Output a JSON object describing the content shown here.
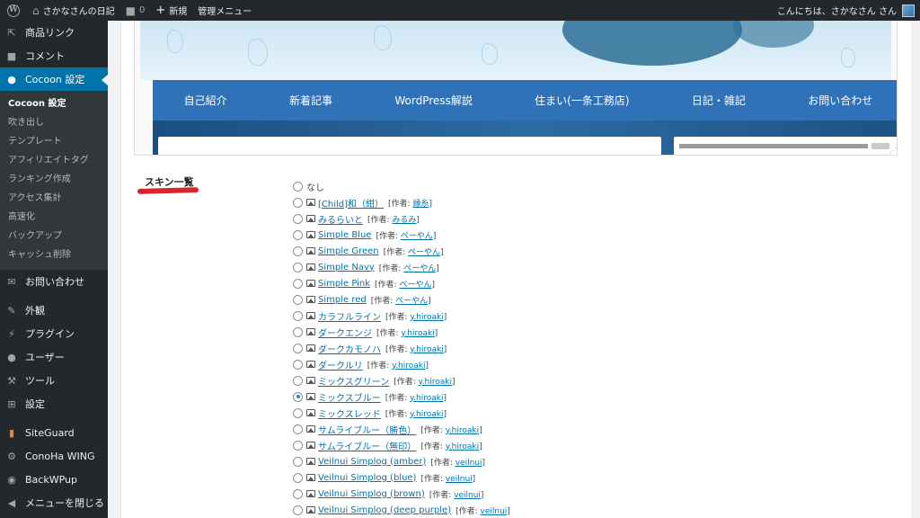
{
  "admin_bar": {
    "site_name": "さかなさんの日記",
    "comments_count": "0",
    "new_label": "新規",
    "admin_menu_label": "管理メニュー",
    "greeting": "こんにちは、さかなさん さん"
  },
  "sidebar": {
    "items_top": [
      {
        "label": "商品リンク",
        "icon": "link-icon"
      },
      {
        "label": "コメント",
        "icon": "comment-icon"
      }
    ],
    "active": {
      "label": "Cocoon 設定",
      "icon": "cocoon-icon"
    },
    "submenu": [
      "Cocoon 設定",
      "吹き出し",
      "テンプレート",
      "アフィリエイトタグ",
      "ランキング作成",
      "アクセス集計",
      "高速化",
      "バックアップ",
      "キャッシュ削除"
    ],
    "items_mid": [
      {
        "label": "お問い合わせ",
        "icon": "mail-icon"
      }
    ],
    "items_bottom": [
      {
        "label": "外観",
        "icon": "brush-icon"
      },
      {
        "label": "プラグイン",
        "icon": "plugin-icon"
      },
      {
        "label": "ユーザー",
        "icon": "user-icon"
      },
      {
        "label": "ツール",
        "icon": "wrench-icon"
      },
      {
        "label": "設定",
        "icon": "settings-icon"
      }
    ],
    "items_plugins": [
      {
        "label": "SiteGuard",
        "icon": "siteguard-icon"
      },
      {
        "label": "ConoHa WING",
        "icon": "gear-icon"
      },
      {
        "label": "BackWPup",
        "icon": "backwpup-icon"
      },
      {
        "label": "メニューを閉じる",
        "icon": "collapse-icon"
      }
    ]
  },
  "preview": {
    "nav_items": [
      "自己紹介",
      "新着記事",
      "WordPress解説",
      "住まい(一条工務店)",
      "日記・雑記",
      "お問い合わせ"
    ]
  },
  "skins": {
    "label": "スキン一覧",
    "author_prefix": "[作者: ",
    "author_suffix": "]",
    "none_label": "なし",
    "items": [
      {
        "name": "[Child]和（紺）",
        "author": "縁糸",
        "checked": false
      },
      {
        "name": "みるらいと",
        "author": "みるみ",
        "checked": false
      },
      {
        "name": "Simple Blue",
        "author": "ぺーやん",
        "checked": false
      },
      {
        "name": "Simple Green",
        "author": "ぺーやん",
        "checked": false
      },
      {
        "name": "Simple Navy",
        "author": "ぺーやん",
        "checked": false
      },
      {
        "name": "Simple Pink",
        "author": "ぺーやん",
        "checked": false
      },
      {
        "name": "Simple red",
        "author": "ぺーやん",
        "checked": false
      },
      {
        "name": "カラフルライン",
        "author": "y.hiroaki",
        "checked": false
      },
      {
        "name": "ダークエンジ",
        "author": "y.hiroaki",
        "checked": false
      },
      {
        "name": "ダークカモノハ",
        "author": "y.hiroaki",
        "checked": false
      },
      {
        "name": "ダークルリ",
        "author": "y.hiroaki",
        "checked": false
      },
      {
        "name": "ミックスグリーン",
        "author": "y.hiroaki",
        "checked": false
      },
      {
        "name": "ミックスブルー",
        "author": "y.hiroaki",
        "checked": true
      },
      {
        "name": "ミックスレッド",
        "author": "y.hiroaki",
        "checked": false
      },
      {
        "name": "サムライブルー（勝色）",
        "author": "y.hiroaki",
        "checked": false
      },
      {
        "name": "サムライブルー（無印）",
        "author": "y.hiroaki",
        "checked": false
      },
      {
        "name": "Veilnui Simplog (amber)",
        "author": "veilnui",
        "checked": false
      },
      {
        "name": "Veilnui Simplog (blue)",
        "author": "veilnui",
        "checked": false
      },
      {
        "name": "Veilnui Simplog (brown)",
        "author": "veilnui",
        "checked": false
      },
      {
        "name": "Veilnui Simplog (deep purple)",
        "author": "veilnui",
        "checked": false
      }
    ]
  },
  "colors": {
    "admin_bg": "#23282d",
    "accent": "#0073aa",
    "nav_blue": "#2f72b8",
    "underline_red": "#d6262b"
  }
}
